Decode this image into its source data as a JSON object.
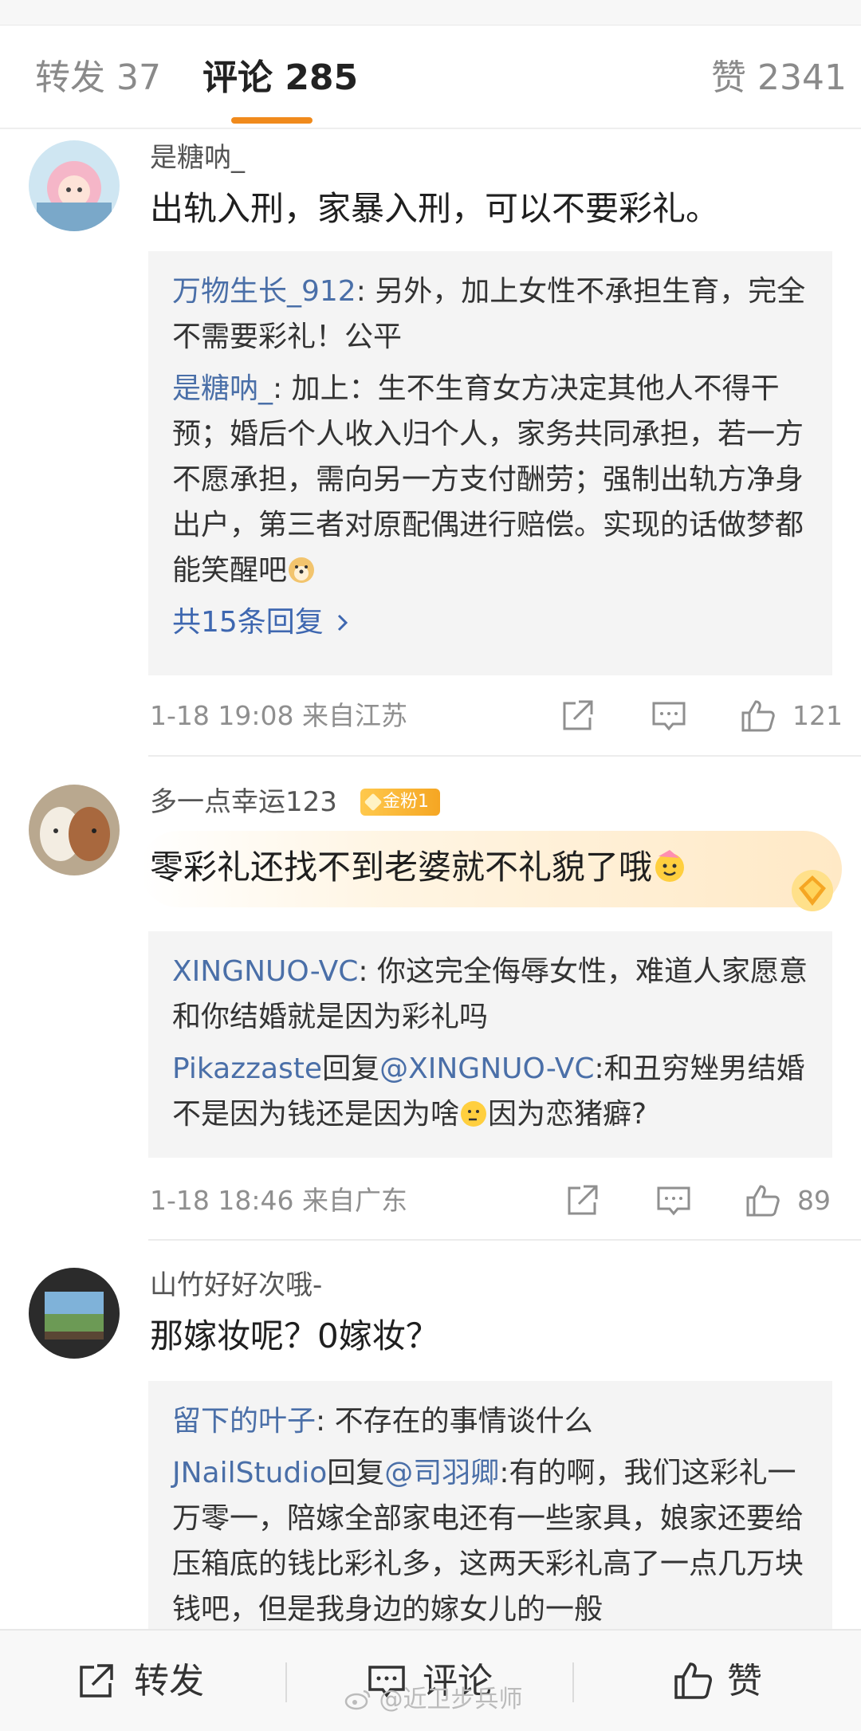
{
  "tabs": {
    "repost": "转发 37",
    "comments": "评论 285",
    "likes": "赞 2341"
  },
  "comments": [
    {
      "user": "是糖呐_",
      "text": "出轨入刑，家暴入刑，可以不要彩礼。",
      "replies": [
        {
          "name": "万物生长_912",
          "text": ": 另外，加上女性不承担生育，完全不需要彩礼！公平"
        },
        {
          "name": "是糖呐_",
          "text": ": 加上：生不生育女方决定其他人不得干预；婚后个人收入归个人，家务共同承担，若一方不愿承担，需向另一方支付酬劳；强制出轨方净身出户，第三者对原配偶进行赔偿。实现的话做梦都能笑醒吧"
        }
      ],
      "more": "共15条回复",
      "meta": "1-18 19:08  来自江苏",
      "likes": "121"
    },
    {
      "user": "多一点幸运123",
      "badge": "金粉1",
      "text": "零彩礼还找不到老婆就不礼貌了哦",
      "replies": [
        {
          "name": "XINGNUO-VC",
          "text": ": 你这完全侮辱女性，难道人家愿意和你结婚就是因为彩礼吗"
        },
        {
          "name": "Pikazzaste",
          "reply_word": "回复",
          "target": "@XINGNUO-VC",
          "text": ":和丑穷矬男结婚不是因为钱还是因为啥",
          "tail": "因为恋猪癖?"
        }
      ],
      "meta": "1-18 18:46  来自广东",
      "likes": "89"
    },
    {
      "user": "山竹好好次哦-",
      "text": "那嫁妆呢？0嫁妆？",
      "replies": [
        {
          "name": "留下的叶子",
          "text": ": 不存在的事情谈什么"
        },
        {
          "name": "JNailStudio",
          "reply_word": "回复",
          "target": "@司羽卿",
          "text": ":有的啊，我们这彩礼一万零一，陪嫁全部家电还有一些家具，娘家还要给压箱底的钱比彩礼多，这两天彩礼高了一点几万块钱吧，但是我身边的嫁女儿的一般"
        }
      ]
    }
  ],
  "bottom": {
    "repost": "转发",
    "comment": "评论",
    "like": "赞"
  },
  "watermark": "@近卫步兵师",
  "icons": [
    "share-icon",
    "comment-icon",
    "like-icon",
    "chevron-right-icon",
    "doge-emoji-icon",
    "party-emoji-icon",
    "thinking-emoji-icon",
    "gem-icon",
    "weibo-logo-icon"
  ],
  "colors": {
    "accent": "#f08a1c",
    "link": "#4a6fa8",
    "reply_bg": "#f4f4f4"
  }
}
